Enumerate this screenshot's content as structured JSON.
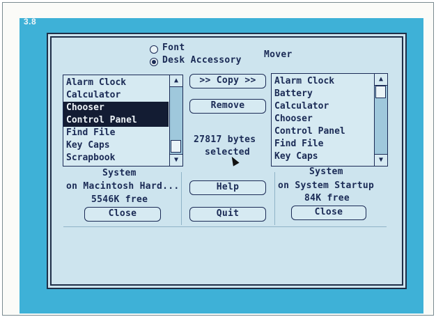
{
  "figure": {
    "label": "3.8"
  },
  "mode": {
    "font_label": "Font",
    "desk_accessory_label": "Desk Accessory",
    "selected": "Desk Accessory",
    "title": "Mover"
  },
  "left_list": {
    "items": [
      "Alarm Clock",
      "Calculator",
      "Chooser",
      "Control Panel",
      "Find File",
      "Key Caps",
      "Scrapbook"
    ],
    "selected": [
      "Chooser",
      "Control Panel"
    ]
  },
  "right_list": {
    "items": [
      "Alarm Clock",
      "Battery",
      "Calculator",
      "Chooser",
      "Control Panel",
      "Find File",
      "Key Caps"
    ]
  },
  "buttons": {
    "copy": ">> Copy >>",
    "remove": "Remove",
    "help": "Help",
    "quit": "Quit",
    "close_left": "Close",
    "close_right": "Close"
  },
  "selection_info": {
    "bytes": "27817 bytes",
    "selected": "selected"
  },
  "left_file": {
    "name": "System",
    "location": "on Macintosh Hard...",
    "free": "5546K free"
  },
  "right_file": {
    "name": "System",
    "location": "on System Startup",
    "free": "84K free"
  },
  "colors": {
    "desktop": "#3eb1d7",
    "dialog": "#cde4ee",
    "ink": "#1a2a55",
    "selection": "#131c33"
  }
}
